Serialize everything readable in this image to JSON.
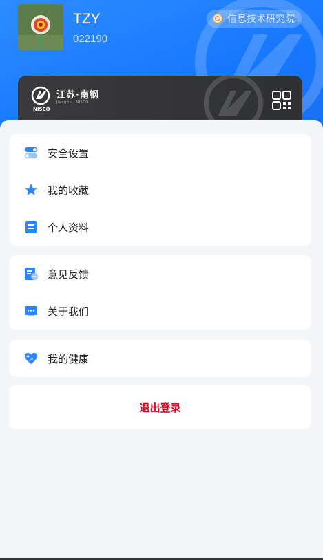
{
  "profile": {
    "name": "TZY",
    "id": "022190",
    "department": "信息技术研究院"
  },
  "card": {
    "brand": "江苏·南钢",
    "brand_sub": "JiangSu · NISCO",
    "brand_short": "NISCO"
  },
  "menu_groups": [
    {
      "items": [
        {
          "label": "安全设置",
          "icon": "toggle-icon"
        },
        {
          "label": "我的收藏",
          "icon": "star-icon"
        },
        {
          "label": "个人资料",
          "icon": "document-icon"
        }
      ]
    },
    {
      "items": [
        {
          "label": "意见反馈",
          "icon": "feedback-icon"
        },
        {
          "label": "关于我们",
          "icon": "about-icon"
        }
      ]
    },
    {
      "items": [
        {
          "label": "我的健康",
          "icon": "heart-icon"
        }
      ]
    }
  ],
  "logout_label": "退出登录",
  "colors": {
    "header_blue": "#1677ff",
    "icon_blue": "#2b85ff",
    "logout_red": "#d9001b"
  }
}
